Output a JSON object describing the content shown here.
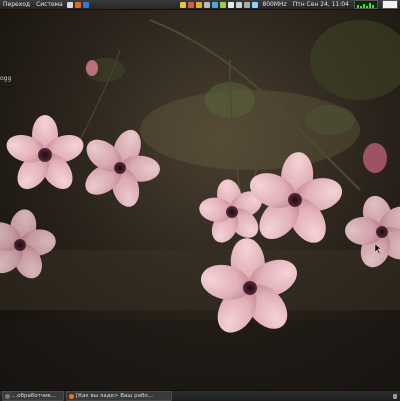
{
  "top_panel": {
    "menu_applications": "Переход",
    "menu_system": "Система",
    "cpu_freq": "800MHz",
    "clock": "Птн Сен 24, 11:04"
  },
  "desktop": {
    "left_label_1": "ogg"
  },
  "taskbar": {
    "tasks": [
      {
        "label": "...обработчик..."
      },
      {
        "label": "[Как вы ладе> Ваш рабо..."
      }
    ]
  },
  "colors": {
    "panel": "#2e2e2e",
    "petal": "#e7b9c0",
    "flower_center": "#3a1626"
  }
}
